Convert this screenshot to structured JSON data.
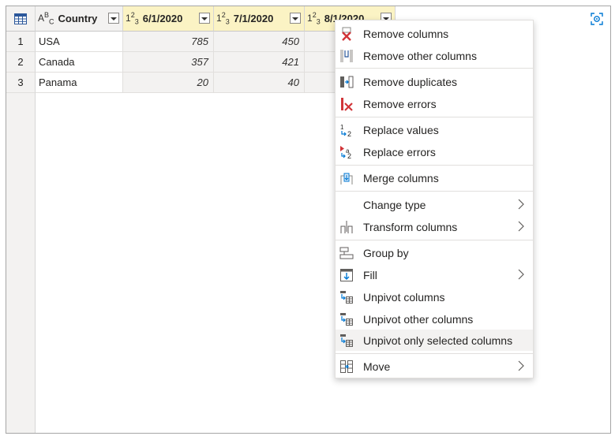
{
  "table": {
    "columns": [
      {
        "type_icon": "text-type-icon",
        "label": "Country"
      },
      {
        "type_icon": "whole-number-type-icon",
        "label": "6/1/2020"
      },
      {
        "type_icon": "whole-number-type-icon",
        "label": "7/1/2020"
      },
      {
        "type_icon": "whole-number-type-icon",
        "label": "8/1/2020"
      }
    ],
    "rows": [
      {
        "num": "1",
        "country": "USA",
        "v1": "785",
        "v2": "450"
      },
      {
        "num": "2",
        "country": "Canada",
        "v1": "357",
        "v2": "421"
      },
      {
        "num": "3",
        "country": "Panama",
        "v1": "20",
        "v2": "40"
      }
    ]
  },
  "context_menu": {
    "items": [
      {
        "label": "Remove columns",
        "icon": "remove-columns-icon"
      },
      {
        "label": "Remove other columns",
        "icon": "remove-other-columns-icon"
      },
      {
        "label": "Remove duplicates",
        "icon": "remove-duplicates-icon"
      },
      {
        "label": "Remove errors",
        "icon": "remove-errors-icon"
      },
      {
        "label": "Replace values",
        "icon": "replace-values-icon"
      },
      {
        "label": "Replace errors",
        "icon": "replace-errors-icon"
      },
      {
        "label": "Merge columns",
        "icon": "merge-columns-icon"
      },
      {
        "label": "Change type",
        "icon": ""
      },
      {
        "label": "Transform columns",
        "icon": "transform-columns-icon"
      },
      {
        "label": "Group by",
        "icon": "group-by-icon"
      },
      {
        "label": "Fill",
        "icon": "fill-icon"
      },
      {
        "label": "Unpivot columns",
        "icon": "unpivot-columns-icon"
      },
      {
        "label": "Unpivot other columns",
        "icon": "unpivot-other-columns-icon"
      },
      {
        "label": "Unpivot only selected columns",
        "icon": "unpivot-selected-columns-icon"
      },
      {
        "label": "Move",
        "icon": "move-icon"
      }
    ]
  },
  "colors": {
    "header_numeric_bg": "#fbf3c4",
    "highlight": "#f3f2f1",
    "accent_blue": "#0078d4",
    "remove_red": "#d13438"
  }
}
